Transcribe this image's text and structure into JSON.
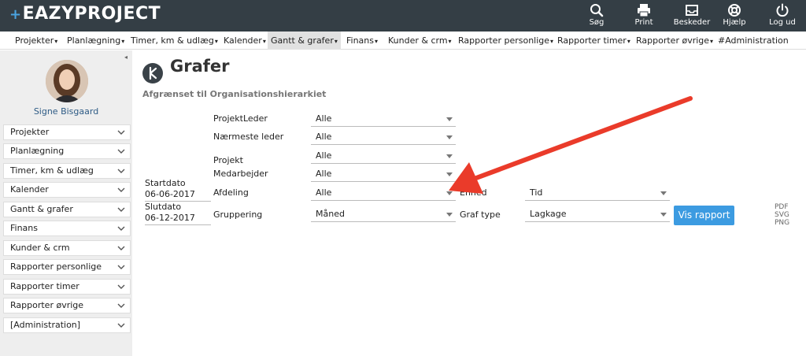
{
  "app": {
    "logo_text": "EAZYPROJECT",
    "logo_plus": "+"
  },
  "toolbar": [
    {
      "name": "search",
      "label": "Søg"
    },
    {
      "name": "print",
      "label": "Print"
    },
    {
      "name": "messages",
      "label": "Beskeder"
    },
    {
      "name": "help",
      "label": "Hjælp"
    },
    {
      "name": "logout",
      "label": "Log ud"
    }
  ],
  "menu": [
    {
      "label": "Projekter",
      "caret": "▾"
    },
    {
      "label": "Planlægning",
      "caret": "▾"
    },
    {
      "label": "Timer, km & udlæg",
      "caret": "▾"
    },
    {
      "label": "Kalender",
      "caret": "▾"
    },
    {
      "label": "Gantt & grafer",
      "caret": "▾"
    },
    {
      "label": "Finans",
      "caret": "▾"
    },
    {
      "label": "Kunder & crm",
      "caret": "▾"
    },
    {
      "label": "Rapporter personlige",
      "caret": "▾"
    },
    {
      "label": "Rapporter timer",
      "caret": "▾"
    },
    {
      "label": "Rapporter øvrige",
      "caret": "▾"
    },
    {
      "label": "#Administration",
      "caret": ""
    }
  ],
  "sidebar": {
    "collapse_glyph": "◂",
    "user_name": "Signe Bisgaard",
    "items": [
      "Projekter",
      "Planlægning",
      "Timer, km & udlæg",
      "Kalender",
      "Gantt & grafer",
      "Finans",
      "Kunder & crm",
      "Rapporter personlige",
      "Rapporter timer",
      "Rapporter øvrige",
      "[Administration]"
    ]
  },
  "main": {
    "title": "Grafer",
    "subtitle": "Afgrænset til Organisationshierarkiet",
    "startdate_label": "Startdato",
    "startdate_value": "06-06-2017",
    "enddate_label": "Slutdato",
    "enddate_value": "06-12-2017",
    "filters": {
      "projektleder": {
        "label": "ProjektLeder",
        "value": "Alle"
      },
      "naermeste_leder": {
        "label": "Nærmeste leder",
        "value": "Alle"
      },
      "projekt": {
        "label": "Projekt",
        "value": "Alle"
      },
      "medarbejder": {
        "label": "Medarbejder",
        "value": "Alle"
      },
      "afdeling": {
        "label": "Afdeling",
        "value": "Alle"
      },
      "gruppering": {
        "label": "Gruppering",
        "value": "Måned"
      },
      "enhed": {
        "label": "Enhed",
        "value": "Tid"
      },
      "graf_type": {
        "label": "Graf type",
        "value": "Lagkage"
      }
    },
    "submit_label": "Vis rapport",
    "exports": [
      "PDF",
      "SVG",
      "PNG"
    ]
  },
  "colors": {
    "topbar": "#343e45",
    "button": "#3c9be1",
    "arrow": "#ea3b2a",
    "link": "#2e5b85"
  }
}
